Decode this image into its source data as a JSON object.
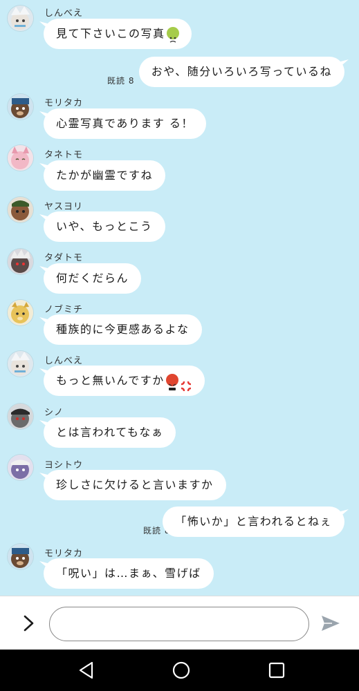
{
  "messages": [
    {
      "side": "left",
      "sender": "しんべえ",
      "text": "見て下さいこの写真",
      "emoji": "nauseated"
    },
    {
      "side": "right",
      "read": "既読 8",
      "text": "おや、随分いろいろ写っているね"
    },
    {
      "side": "left",
      "sender": "モリタカ",
      "text": "心霊写真であります る！"
    },
    {
      "side": "left",
      "sender": "タネトモ",
      "text": "たかが幽霊ですね"
    },
    {
      "side": "left",
      "sender": "ヤスヨリ",
      "text": "いや、もっとこう"
    },
    {
      "side": "left",
      "sender": "タダトモ",
      "text": "何だくだらん"
    },
    {
      "side": "left",
      "sender": "ノブミチ",
      "text": "種族的に今更感あるよな"
    },
    {
      "side": "left",
      "sender": "しんべえ",
      "text": "もっと無いんですか",
      "emoji": "angry-cursing"
    },
    {
      "side": "left",
      "sender": "シノ",
      "text": "とは言われてもなぁ"
    },
    {
      "side": "left",
      "sender": "ヨシトウ",
      "text": "珍しさに欠けると言いますか"
    },
    {
      "side": "right",
      "read": "既読 8",
      "text": "「怖いか」と言われるとねぇ"
    },
    {
      "side": "left",
      "sender": "モリタカ",
      "text": "「呪い」は…まぁ、雪げば"
    }
  ],
  "input": {
    "placeholder": "",
    "value": ""
  },
  "icons": {
    "expand": "chevron-right-icon",
    "send": "send-icon",
    "back": "back-triangle-icon",
    "home": "home-circle-icon",
    "recents": "recents-square-icon"
  },
  "colors": {
    "background": "#c9ecf7",
    "bubble": "#ffffff",
    "navbar": "#000000"
  }
}
